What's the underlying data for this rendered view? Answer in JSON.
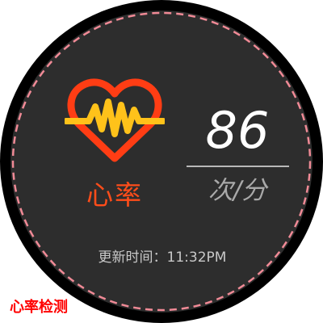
{
  "heart_rate": {
    "title": "心率",
    "value": "86",
    "unit": "次/分"
  },
  "update": {
    "label": "更新时间：",
    "time": "11:32PM"
  },
  "caption": "心率检测",
  "icons": {
    "heart": "heart-pulse-icon"
  },
  "colors": {
    "face_background": "#2d2d2d",
    "bezel": "#000000",
    "dashed_ring": "#f08a96",
    "heart_stroke": "#ff3d14",
    "pulse_line": "#ffc21a",
    "title": "#ff4d1a",
    "value": "#ffffff",
    "unit": "#a9a9a9",
    "caption": "#ff0000"
  }
}
